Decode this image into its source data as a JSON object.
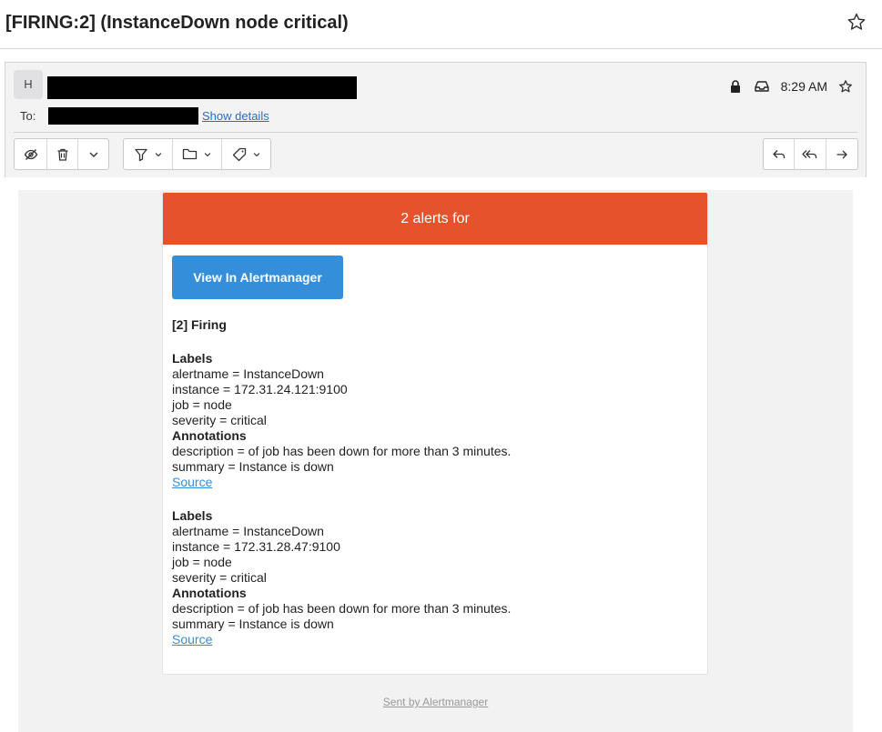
{
  "subject": {
    "title": "[FIRING:2] (InstanceDown node critical)"
  },
  "header": {
    "avatar_initial": "H",
    "time": "8:29 AM",
    "to_label": "To:",
    "show_details": "Show details"
  },
  "toolbar": {
    "icons": [
      "unread-icon",
      "trash-icon",
      "chevron-down-icon",
      "filter-icon",
      "folder-icon",
      "tag-icon",
      "reply-icon",
      "reply-all-icon",
      "forward-icon"
    ]
  },
  "email": {
    "header_text": "2 alerts for",
    "button_label": "View In Alertmanager",
    "firing_label": "[2] Firing",
    "alerts": [
      {
        "labels_heading": "Labels",
        "alertname": "alertname = InstanceDown",
        "instance": "instance = 172.31.24.121:9100",
        "job": "job = node",
        "severity": "severity = critical",
        "annotations_heading": "Annotations",
        "description": "description = of job has been down for more than 3 minutes.",
        "summary": "summary = Instance is down",
        "source": "Source"
      },
      {
        "labels_heading": "Labels",
        "alertname": "alertname = InstanceDown",
        "instance": "instance = 172.31.28.47:9100",
        "job": "job = node",
        "severity": "severity = critical",
        "annotations_heading": "Annotations",
        "description": "description = of job has been down for more than 3 minutes.",
        "summary": "summary = Instance is down",
        "source": "Source"
      }
    ],
    "footer": "Sent by Alertmanager"
  },
  "colors": {
    "alert_header": "#e6522c",
    "button": "#348eda",
    "link": "#2b6cc4"
  }
}
